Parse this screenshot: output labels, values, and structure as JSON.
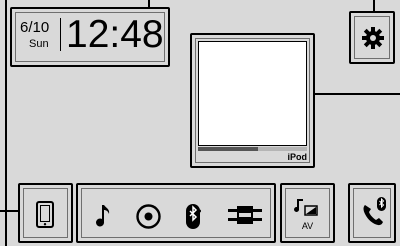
{
  "clock": {
    "month_day": "6/10",
    "weekday": "Sun",
    "time": "12:48"
  },
  "now_playing": {
    "source_label": "iPod",
    "progress": 0.55
  },
  "sources": {
    "av_label": "AV",
    "icons": [
      "phone-icon",
      "music-note-icon",
      "disc-icon",
      "bluetooth-icon",
      "aux-connector-icon",
      "av-icon",
      "settings-gear-icon",
      "phone-call-icon"
    ]
  },
  "colors": {
    "background": "#d9d9d9",
    "border": "#000000",
    "album_art": "#ffffff"
  }
}
